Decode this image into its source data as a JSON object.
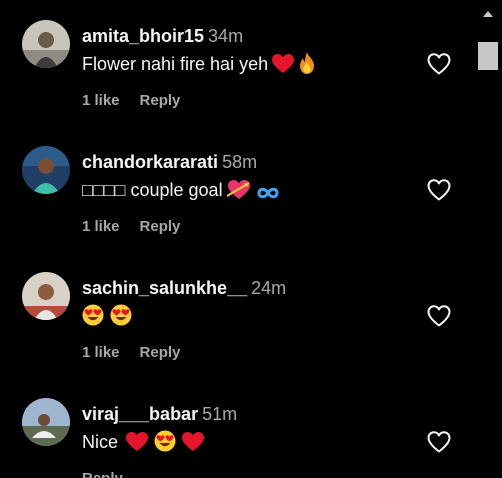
{
  "comments": [
    {
      "username": "amita_bhoir15",
      "time": "34m",
      "text": "Flower nahi fire hai yeh",
      "emojis": [
        "red-heart",
        "fire"
      ],
      "likes": "1 like",
      "reply": "Reply"
    },
    {
      "username": "chandorkararati",
      "time": "58m",
      "text": "□□□□ couple goal",
      "emojis": [
        "heart-with-arrow",
        "infinity"
      ],
      "likes": "1 like",
      "reply": "Reply"
    },
    {
      "username": "sachin_salunkhe__",
      "time": "24m",
      "text": "",
      "emojis": [
        "heart-eyes",
        "heart-eyes"
      ],
      "likes": "1 like",
      "reply": "Reply"
    },
    {
      "username": "viraj___babar",
      "time": "51m",
      "text": "Nice",
      "emojis": [
        "red-heart",
        "heart-eyes",
        "red-heart"
      ],
      "likes": "",
      "reply": "Reply"
    }
  ],
  "colors": {
    "background": "#000000",
    "text": "#f5f5f5",
    "secondary": "#a8a8a8",
    "scroll_thumb": "#c8c8c8"
  }
}
